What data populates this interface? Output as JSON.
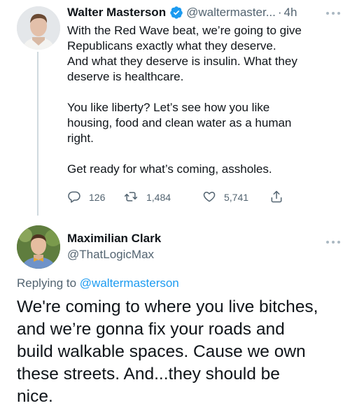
{
  "tweet": {
    "author_name": "Walter Masterson",
    "author_handle": "@waltermaster...",
    "separator": "·",
    "time": "4h",
    "body": [
      "With the Red Wave beat, we’re going to give",
      "Republicans exactly what they deserve.",
      "And what they deserve is insulin. What they",
      "deserve is healthcare.",
      "You like liberty? Let’s see how you like",
      "housing, food and clean water as a human",
      "right.",
      "Get ready for what’s coming, assholes."
    ],
    "replies": "126",
    "retweets": "1,484",
    "likes": "5,741"
  },
  "reply": {
    "author_name": "Maximilian Clark",
    "author_handle": "@ThatLogicMax",
    "replying_to_prefix": "Replying to",
    "replying_to_handle": "@waltermasterson",
    "body": [
      "We're coming to where you live bitches,",
      "and we’re gonna fix your roads and",
      "build walkable spaces. Cause we own",
      "these streets. And...they should be",
      "nice."
    ]
  },
  "colors": {
    "text": "#0f1419",
    "secondary": "#536471",
    "link": "#1d9bf0",
    "verified": "#1d9bf0",
    "thread_line": "#cfd9de"
  },
  "icons": [
    "verified-badge-icon",
    "more-icon",
    "reply-icon",
    "retweet-icon",
    "like-icon",
    "share-icon"
  ]
}
